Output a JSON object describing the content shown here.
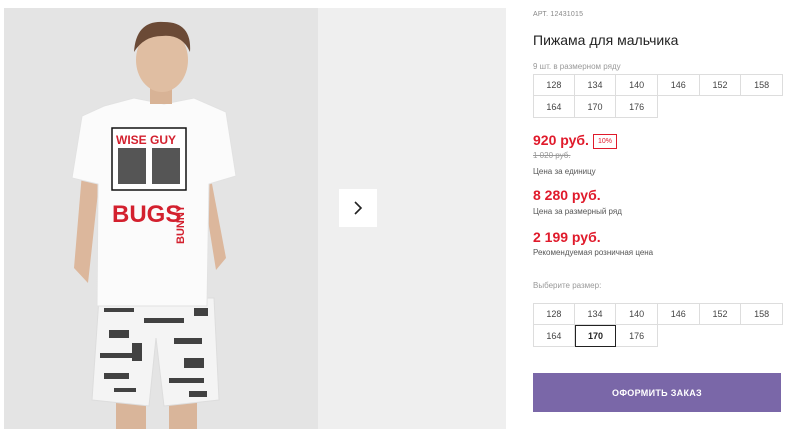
{
  "product": {
    "sku": "АРТ. 12431015",
    "title": "Пижама для мальчика",
    "image_alt": "product-photo",
    "print_text_top": "WISE GUY",
    "print_text_main": "BUGS",
    "print_text_side": "BUNNY"
  },
  "sizes_in_range": {
    "note": "9 шт. в размерном ряду",
    "values": [
      "128",
      "134",
      "140",
      "146",
      "152",
      "158",
      "164",
      "170",
      "176"
    ]
  },
  "pricing": {
    "unit_price": "920 руб.",
    "discount": "10%",
    "old_price": "1 020 руб.",
    "unit_label": "Цена за единицу",
    "range_price": "8 280 руб.",
    "range_label": "Цена за размерный ряд",
    "retail_price": "2 199 руб.",
    "retail_label": "Рекомендуемая розничная цена"
  },
  "size_picker": {
    "label": "Выберите размер:",
    "values": [
      "128",
      "134",
      "140",
      "146",
      "152",
      "158",
      "164",
      "170",
      "176"
    ],
    "selected": "170"
  },
  "actions": {
    "order_label": "ОФОРМИТЬ ЗАКАЗ"
  },
  "colors": {
    "price_red": "#e01a2b",
    "button_purple": "#7a67a8"
  }
}
